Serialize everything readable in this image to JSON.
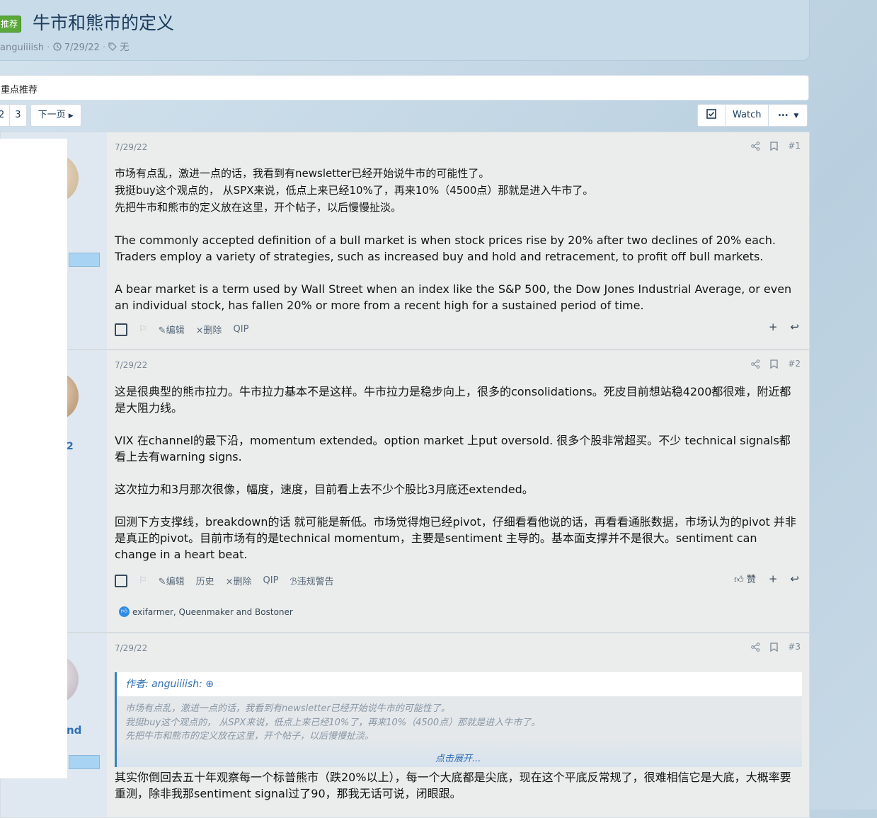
{
  "thread": {
    "badge": "推荐",
    "title": "牛市和熊市的定义",
    "author": "anguiiiish",
    "date": "7/29/22",
    "tags": "无"
  },
  "breadcrumb": "重点推荐",
  "pagination": {
    "pages": [
      "2",
      "3"
    ],
    "next": "下一页"
  },
  "toolbar": {
    "watch": "Watch",
    "more": "•••"
  },
  "posts": [
    {
      "date": "7/29/22",
      "number": "#1",
      "paragraphs": [
        "市场有点乱，激进一点的话，我看到有newsletter已经开始说牛市的可能性了。\n我挺buy这个观点的，  从SPX来说，低点上来已经10%了，再来10%（4500点）那就是进入牛市了。\n先把牛市和熊市的定义放在这里，开个帖子，以后慢慢扯淡。",
        "The commonly accepted definition of a bull market is when stock prices rise by 20% after two declines of 20% each. Traders employ a variety of strategies, such as increased buy and hold and retracement, to profit off bull markets.",
        "A bear market is a term used by Wall Street when an index like the S&P 500, the Dow Jones Industrial Average, or even an individual stock, has fallen 20% or more from a recent high for a sustained period of time."
      ],
      "actions": {
        "edit": "编辑",
        "delete": "删除",
        "ip": "IP"
      }
    },
    {
      "date": "7/29/22",
      "number": "#2",
      "side_name": "2",
      "paragraphs": [
        "这是很典型的熊市拉力。牛市拉力基本不是这样。牛市拉力是稳步向上，很多的consolidations。死皮目前想站稳4200都很难，附近都是大阻力线。",
        "VIX 在channel的最下沿，momentum extended。option market 上put oversold. 很多个股非常超买。不少 technical signals都看上去有warning signs.",
        "这次拉力和3月那次很像，幅度，速度，目前看上去不少个股比3月底还extended。",
        "回测下方支撑线，breakdown的话 就可能是新低。市场觉得炮已经pivot，仔细看看他说的话，再看看通胀数据，市场认为的pivot 并非是真正的pivot。目前市场有的是technical momentum，主要是sentiment 主导的。基本面支撑并不是很大。sentiment can change in a heart beat."
      ],
      "actions": {
        "edit": "编辑",
        "history": "历史",
        "delete": "删除",
        "ip": "IP",
        "warn": "违规警告",
        "like": "赞"
      },
      "reactions": "exifarmer, Queenmaker and Bostoner"
    },
    {
      "date": "7/29/22",
      "number": "#3",
      "side_name": "nd",
      "quote": {
        "author": "作者: anguiiiish:",
        "lines": [
          "市场有点乱，激进一点的话，我看到有newsletter已经开始说牛市的可能性了。",
          "我挺buy这个观点的，  从SPX来说，低点上来已经10%了，再来10%（4500点）那就是进入牛市了。",
          "先把牛市和熊市的定义放在这里，开个帖子，以后慢慢扯淡。"
        ],
        "expand": "点击展开..."
      },
      "paragraphs": [
        "其实你倒回去五十年观察每一个标普熊市（跌20%以上），每一个大底都是尖底，现在这个平底反常规了，很难相信它是大底，大概率要重测，除非我那sentiment signal过了90，那我无话可说，闭眼跟。"
      ]
    }
  ]
}
